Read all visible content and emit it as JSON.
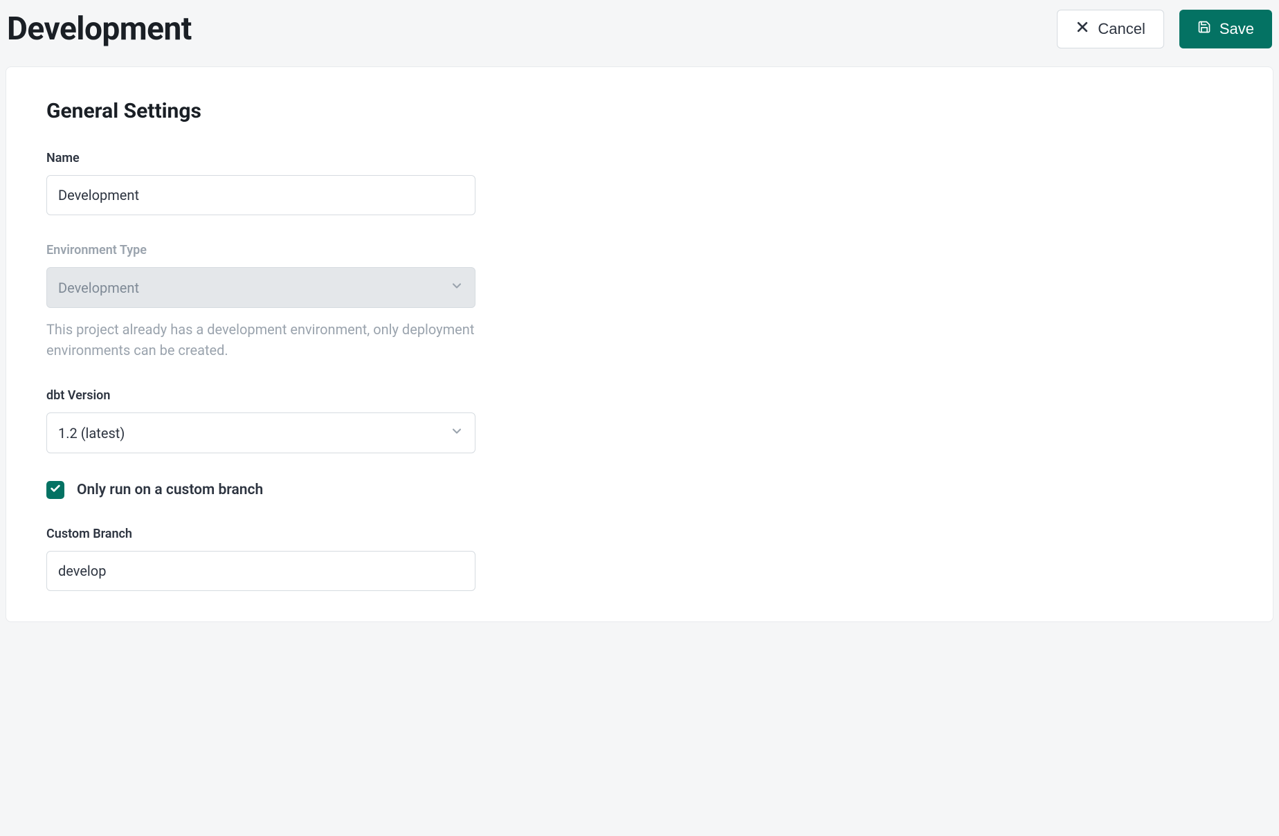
{
  "header": {
    "title": "Development",
    "cancel_label": "Cancel",
    "save_label": "Save"
  },
  "section": {
    "title": "General Settings"
  },
  "form": {
    "name": {
      "label": "Name",
      "value": "Development"
    },
    "environment_type": {
      "label": "Environment Type",
      "value": "Development",
      "help": "This project already has a development environment, only deployment environments can be created."
    },
    "dbt_version": {
      "label": "dbt Version",
      "value": "1.2 (latest)"
    },
    "custom_branch_toggle": {
      "label": "Only run on a custom branch",
      "checked": true
    },
    "custom_branch": {
      "label": "Custom Branch",
      "value": "develop"
    }
  },
  "colors": {
    "primary": "#047263",
    "text": "#1a1f25",
    "muted": "#9aa3ad",
    "border": "#d6dbe0"
  }
}
